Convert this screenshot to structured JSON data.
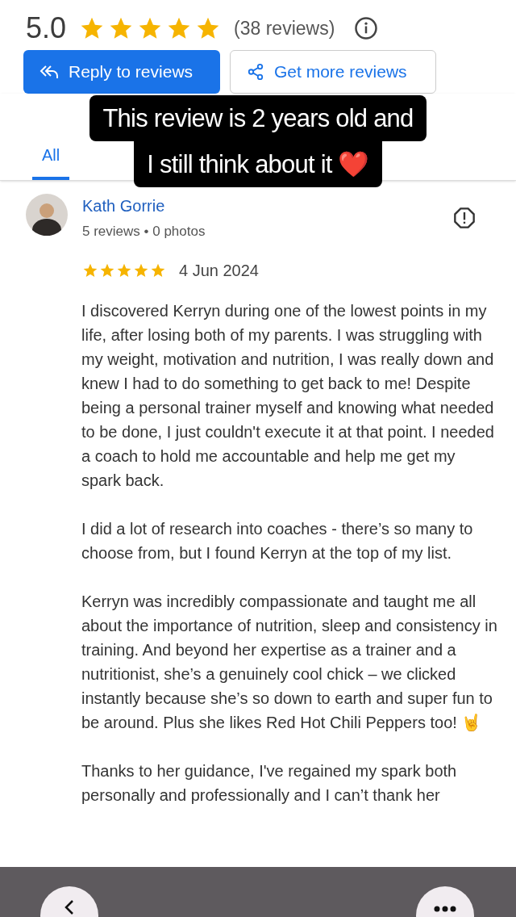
{
  "summary": {
    "rating": "5.0",
    "stars": 5,
    "count": "(38 reviews)"
  },
  "actions": [
    {
      "kind": "primary",
      "label": "Reply to reviews"
    },
    {
      "kind": "secondary",
      "label": "Get more reviews"
    }
  ],
  "tabs": [
    {
      "label": "All",
      "selected": true
    }
  ],
  "caption": {
    "lines": [
      "This review is 2 years old and",
      "I still think about it ❤️"
    ]
  },
  "review": {
    "author": "Kath Gorrie",
    "meta": "5 reviews • 0 photos",
    "stars": 5,
    "date": "4 Jun 2024",
    "paragraphs": [
      "I discovered Kerryn during one of the lowest points in my life, after losing both of my parents. I was struggling with my weight, motivation and nutrition, I was really down and knew I had to do something to get back to me! Despite being a personal trainer myself and knowing what needed to be done, I just couldn't execute it at that point. I needed a coach to hold me accountable and help me get my spark back.",
      "I did a lot of research into coaches - there’s so many to choose from, but I found Kerryn at the top of my list.",
      "Kerryn was incredibly compassionate and taught me all about the importance of nutrition, sleep and consistency in training. And beyond her expertise as a trainer and a nutritionist, she’s a genuinely cool chick – we clicked instantly because she’s so down to earth and super fun to be around. Plus she likes Red Hot Chili Peppers too! 🤘",
      "Thanks to her guidance, I've regained my spark both personally and professionally and I can’t thank her"
    ]
  }
}
